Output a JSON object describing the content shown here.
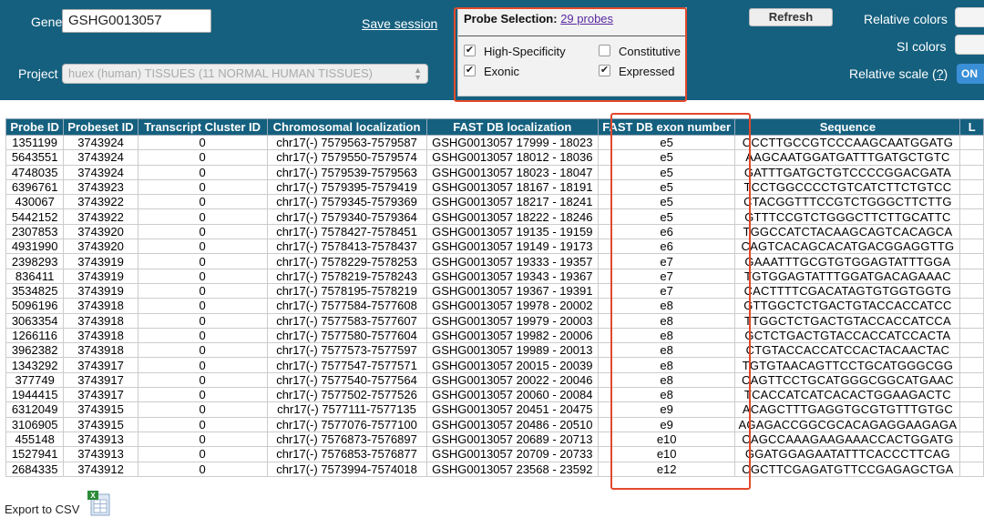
{
  "header": {
    "gene_label": "Gene",
    "gene_value": "GSHG0013057",
    "save_session": "Save session",
    "project_label": "Project",
    "project_value": "huex (human) TISSUES (11 NORMAL HUMAN TISSUES)",
    "probe_selection": {
      "title": "Probe Selection:",
      "count_link": "29 probes",
      "options": [
        {
          "label": "High-Specificity",
          "checked": true
        },
        {
          "label": "Constitutive",
          "checked": false
        },
        {
          "label": "Exonic",
          "checked": true
        },
        {
          "label": "Expressed",
          "checked": true
        }
      ]
    },
    "refresh": "Refresh",
    "relative_colors": "Relative colors",
    "si_colors": "SI colors",
    "relative_scale": "Relative scale (?)",
    "relative_scale_link": "?",
    "relative_scale_state": "ON"
  },
  "table": {
    "columns": [
      "Probe ID",
      "Probeset ID",
      "Transcript Cluster ID",
      "Chromosomal localization",
      "FAST DB localization",
      "FAST DB exon number",
      "Sequence",
      "L"
    ],
    "rows": [
      [
        "1351199",
        "3743924",
        "0",
        "chr17(-) 7579563-7579587",
        "GSHG0013057 17999 - 18023",
        "e5",
        "CCCTTGCCGTCCCAAGCAATGGATG"
      ],
      [
        "5643551",
        "3743924",
        "0",
        "chr17(-) 7579550-7579574",
        "GSHG0013057 18012 - 18036",
        "e5",
        "AAGCAATGGATGATTTGATGCTGTC"
      ],
      [
        "4748035",
        "3743924",
        "0",
        "chr17(-) 7579539-7579563",
        "GSHG0013057 18023 - 18047",
        "e5",
        "GATTTGATGCTGTCCCCGGACGATA"
      ],
      [
        "6396761",
        "3743923",
        "0",
        "chr17(-) 7579395-7579419",
        "GSHG0013057 18167 - 18191",
        "e5",
        "TCCTGGCCCCTGTCATCTTCTGTCC"
      ],
      [
        "430067",
        "3743922",
        "0",
        "chr17(-) 7579345-7579369",
        "GSHG0013057 18217 - 18241",
        "e5",
        "CTACGGTTTCCGTCTGGGCTTCTTG"
      ],
      [
        "5442152",
        "3743922",
        "0",
        "chr17(-) 7579340-7579364",
        "GSHG0013057 18222 - 18246",
        "e5",
        "GTTTCCGTCTGGGCTTCTTGCATTC"
      ],
      [
        "2307853",
        "3743920",
        "0",
        "chr17(-) 7578427-7578451",
        "GSHG0013057 19135 - 19159",
        "e6",
        "TGGCCATCTACAAGCAGTCACAGCA"
      ],
      [
        "4931990",
        "3743920",
        "0",
        "chr17(-) 7578413-7578437",
        "GSHG0013057 19149 - 19173",
        "e6",
        "CAGTCACAGCACATGACGGAGGTTG"
      ],
      [
        "2398293",
        "3743919",
        "0",
        "chr17(-) 7578229-7578253",
        "GSHG0013057 19333 - 19357",
        "e7",
        "GAAATTTGCGTGTGGAGTATTTGGA"
      ],
      [
        "836411",
        "3743919",
        "0",
        "chr17(-) 7578219-7578243",
        "GSHG0013057 19343 - 19367",
        "e7",
        "TGTGGAGTATTTGGATGACAGAAAC"
      ],
      [
        "3534825",
        "3743919",
        "0",
        "chr17(-) 7578195-7578219",
        "GSHG0013057 19367 - 19391",
        "e7",
        "CACTTTTCGACATAGTGTGGTGGTG"
      ],
      [
        "5096196",
        "3743918",
        "0",
        "chr17(-) 7577584-7577608",
        "GSHG0013057 19978 - 20002",
        "e8",
        "GTTGGCTCTGACTGTACCACCATCC"
      ],
      [
        "3063354",
        "3743918",
        "0",
        "chr17(-) 7577583-7577607",
        "GSHG0013057 19979 - 20003",
        "e8",
        "TTGGCTCTGACTGTACCACCATCCA"
      ],
      [
        "1266116",
        "3743918",
        "0",
        "chr17(-) 7577580-7577604",
        "GSHG0013057 19982 - 20006",
        "e8",
        "GCTCTGACTGTACCACCATCCACTA"
      ],
      [
        "3962382",
        "3743918",
        "0",
        "chr17(-) 7577573-7577597",
        "GSHG0013057 19989 - 20013",
        "e8",
        "CTGTACCACCATCCACTACAACTAC"
      ],
      [
        "1343292",
        "3743917",
        "0",
        "chr17(-) 7577547-7577571",
        "GSHG0013057 20015 - 20039",
        "e8",
        "TGTGTAACAGTTCCTGCATGGGCGG"
      ],
      [
        "377749",
        "3743917",
        "0",
        "chr17(-) 7577540-7577564",
        "GSHG0013057 20022 - 20046",
        "e8",
        "CAGTTCCTGCATGGGCGGCATGAAC"
      ],
      [
        "1944415",
        "3743917",
        "0",
        "chr17(-) 7577502-7577526",
        "GSHG0013057 20060 - 20084",
        "e8",
        "TCACCATCATCACACTGGAAGACTC"
      ],
      [
        "6312049",
        "3743915",
        "0",
        "chr17(-) 7577111-7577135",
        "GSHG0013057 20451 - 20475",
        "e9",
        "ACAGCTTTGAGGTGCGTGTTTGTGC"
      ],
      [
        "3106905",
        "3743915",
        "0",
        "chr17(-) 7577076-7577100",
        "GSHG0013057 20486 - 20510",
        "e9",
        "AGAGACCGGCGCACAGAGGAAGAGA"
      ],
      [
        "455148",
        "3743913",
        "0",
        "chr17(-) 7576873-7576897",
        "GSHG0013057 20689 - 20713",
        "e10",
        "CAGCCAAAGAAGAAACCACTGGATG"
      ],
      [
        "1527941",
        "3743913",
        "0",
        "chr17(-) 7576853-7576877",
        "GSHG0013057 20709 - 20733",
        "e10",
        "GGATGGAGAATATTTCACCCTTCAG"
      ],
      [
        "2684335",
        "3743912",
        "0",
        "chr17(-) 7573994-7574018",
        "GSHG0013057 23568 - 23592",
        "e12",
        "CGCTTCGAGATGTTCCGAGAGCTGA"
      ]
    ]
  },
  "footer": {
    "export_label": "Export to CSV"
  },
  "colors": {
    "panel_bg": "#15607f",
    "header_bg": "#15607f",
    "highlight": "#e2492b",
    "on_button": "#3a8fd6"
  }
}
